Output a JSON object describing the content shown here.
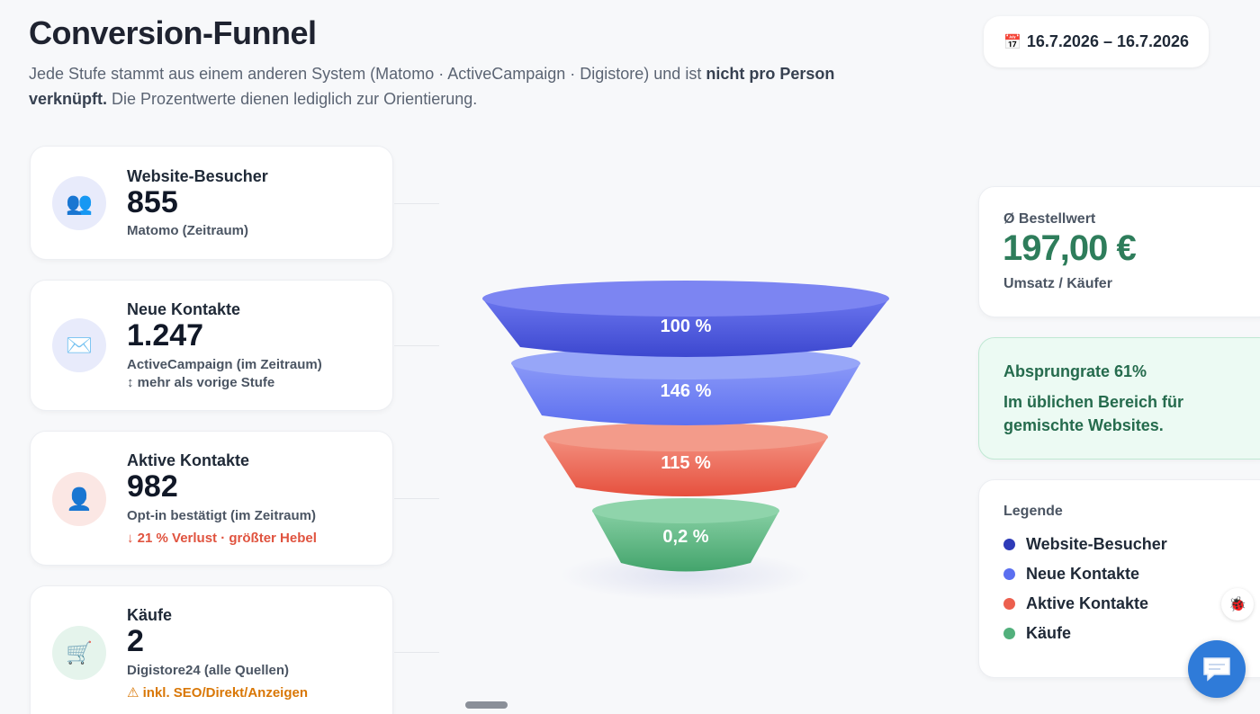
{
  "header": {
    "title": "Conversion-Funnel",
    "subtitle_part1": "Jede Stufe stammt aus einem anderen System (Matomo · ActiveCampaign · Digistore) und ist ",
    "subtitle_bold": "nicht pro Person verknüpft.",
    "subtitle_part2": " Die Prozentwerte dienen lediglich zur Orientierung.",
    "date_icon": "📅",
    "date_range": "16.7.2026 – 16.7.2026"
  },
  "stages": [
    {
      "label": "Website-Besucher",
      "value": "855",
      "source": "Matomo (Zeitraum)",
      "note": "",
      "icon": "👥",
      "icon_name": "users-icon",
      "percent": "100 %",
      "color": "#4a56dd"
    },
    {
      "label": "Neue Kontakte",
      "value": "1.247",
      "source": "ActiveCampaign (im Zeitraum)",
      "note": "↕ mehr als vorige Stufe",
      "icon": "✉️",
      "icon_name": "envelope-icon",
      "percent": "146 %",
      "color": "#6377f0"
    },
    {
      "label": "Aktive Kontakte",
      "value": "982",
      "source": "Opt-in bestätigt (im Zeitraum)",
      "note": "↓ 21 % Verlust · größter Hebel",
      "icon": "👤",
      "icon_name": "person-icon",
      "percent": "115 %",
      "color": "#ec5f4e"
    },
    {
      "label": "Käufe",
      "value": "2",
      "source": "Digistore24 (alle Quellen)",
      "note": "⚠ inkl. SEO/Direkt/Anzeigen",
      "icon": "🛒",
      "icon_name": "cart-icon",
      "percent": "0,2 %",
      "color": "#52b07c"
    }
  ],
  "aov": {
    "label": "Ø Bestellwert",
    "value": "197,00 €",
    "sub": "Umsatz / Käufer"
  },
  "bounce": {
    "title": "Absprungrate 61%",
    "text": "Im üblichen Bereich für gemischte Websites."
  },
  "legend": {
    "title": "Legende",
    "items": [
      {
        "label": "Website-Besucher",
        "color": "#2e3bb8"
      },
      {
        "label": "Neue Kontakte",
        "color": "#5b6ff0"
      },
      {
        "label": "Aktive Kontakte",
        "color": "#ec5f4e"
      },
      {
        "label": "Käufe",
        "color": "#52b07c"
      }
    ]
  },
  "widgets": {
    "bug_icon": "🐞",
    "chat_icon": "chat-bubble-icon"
  }
}
